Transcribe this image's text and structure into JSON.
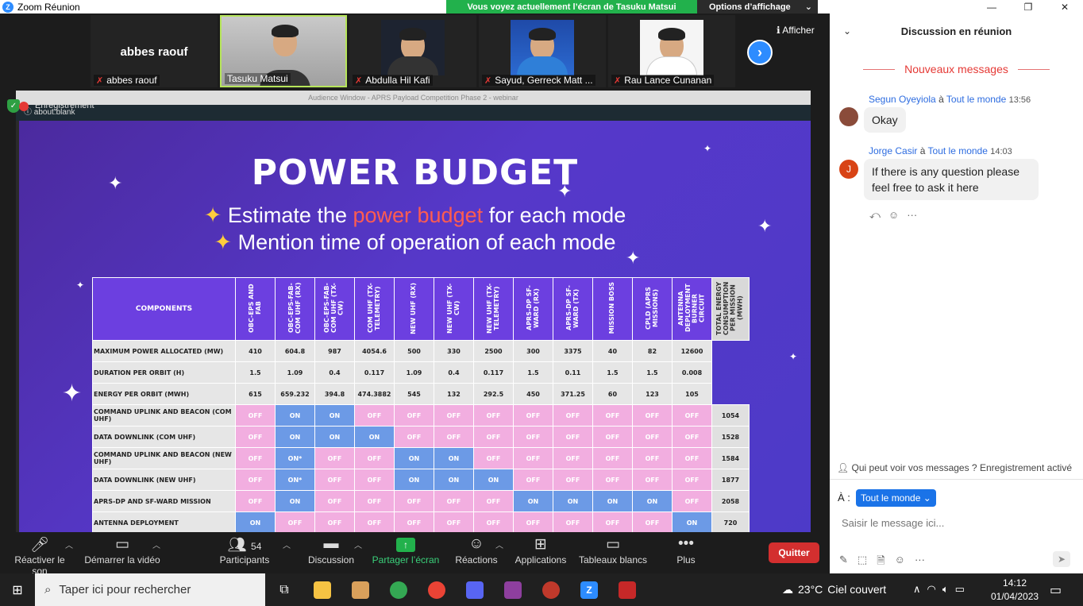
{
  "window": {
    "title": "Zoom Réunion",
    "share_banner": "Vous voyez actuellement l’écran de Tasuku Matsui",
    "view_options": "Options d’affichage",
    "minimize": "—",
    "restore": "❐",
    "close": "✕"
  },
  "strip": {
    "afficher": "Afficher",
    "tiles": [
      {
        "name": "abbes raouf",
        "center": "abbes raouf"
      },
      {
        "name": "Tasuku Matsui"
      },
      {
        "name": "Abdulla Hil Kafi"
      },
      {
        "name": "Sayud, Gerreck Matt ..."
      },
      {
        "name": "Rau Lance Cunanan"
      }
    ]
  },
  "share": {
    "browser_title": "Audience Window - APRS Payload Competition Phase 2 - webinar",
    "address": "about:blank",
    "recording": "Enregistrement"
  },
  "slide": {
    "title": "POWER BUDGET",
    "bullet1_pre": "Estimate the ",
    "bullet1_hl": "power budget",
    "bullet1_post": " for each mode",
    "bullet2": "Mention time of operation of each mode"
  },
  "table": {
    "components_header": "COMPONENTS",
    "total_header": "TOTAL ENERGY CONSUMPTION PER MISSION (MWH)",
    "columns": [
      "OBC-EPS AND FAB",
      "OBC-EPS-FAB-COM UHF (RX)",
      "OBC-EPS-FAB-COM UHF (TX-CW)",
      "COM UHF (TX-TELEMETRY)",
      "NEW UHF (RX)",
      "NEW UHF (TX-CW)",
      "NEW UHF (TX-TELEMETRY)",
      "APRS-DP SF-WARD (RX)",
      "APRS-DP SF-WARD (TX)",
      "MISSION BOSS",
      "CPLD (APRS MISSIONS)",
      "ANTENNA DEPLOYMENT BURNER CIRCUIT"
    ],
    "numeric_rows": [
      {
        "label": "MAXIMUM POWER ALLOCATED (MW)",
        "values": [
          "410",
          "604.8",
          "987",
          "4054.6",
          "500",
          "330",
          "2500",
          "300",
          "3375",
          "40",
          "82",
          "12600"
        ]
      },
      {
        "label": "DURATION PER ORBIT (H)",
        "values": [
          "1.5",
          "1.09",
          "0.4",
          "0.117",
          "1.09",
          "0.4",
          "0.117",
          "1.5",
          "0.11",
          "1.5",
          "1.5",
          "0.008"
        ]
      },
      {
        "label": "ENERGY PER ORBIT (MWH)",
        "values": [
          "615",
          "659.232",
          "394.8",
          "474.3882",
          "545",
          "132",
          "292.5",
          "450",
          "371.25",
          "60",
          "123",
          "105"
        ]
      }
    ],
    "mode_rows": [
      {
        "label": "COMMAND UPLINK AND BEACON (COM UHF)",
        "states": [
          "OFF",
          "ON",
          "ON",
          "OFF",
          "OFF",
          "OFF",
          "OFF",
          "OFF",
          "OFF",
          "OFF",
          "OFF",
          "OFF"
        ],
        "total": "1054"
      },
      {
        "label": "DATA DOWNLINK (COM UHF)",
        "states": [
          "OFF",
          "ON",
          "ON",
          "ON",
          "OFF",
          "OFF",
          "OFF",
          "OFF",
          "OFF",
          "OFF",
          "OFF",
          "OFF"
        ],
        "total": "1528"
      },
      {
        "label": "COMMAND UPLINK AND BEACON (NEW UHF)",
        "states": [
          "OFF",
          "ON*",
          "OFF",
          "OFF",
          "ON",
          "ON",
          "OFF",
          "OFF",
          "OFF",
          "OFF",
          "OFF",
          "OFF"
        ],
        "total": "1584"
      },
      {
        "label": "DATA DOWNLINK (NEW UHF)",
        "states": [
          "OFF",
          "ON*",
          "OFF",
          "OFF",
          "ON",
          "ON",
          "ON",
          "OFF",
          "OFF",
          "OFF",
          "OFF",
          "OFF"
        ],
        "total": "1877"
      },
      {
        "label": "APRS-DP AND SF-WARD MISSION",
        "states": [
          "OFF",
          "ON",
          "OFF",
          "OFF",
          "OFF",
          "OFF",
          "OFF",
          "ON",
          "ON",
          "ON",
          "ON",
          "OFF"
        ],
        "total": "2058"
      },
      {
        "label": "ANTENNA DEPLOYMENT",
        "states": [
          "ON",
          "OFF",
          "OFF",
          "OFF",
          "OFF",
          "OFF",
          "OFF",
          "OFF",
          "OFF",
          "OFF",
          "OFF",
          "ON"
        ],
        "total": "720"
      }
    ]
  },
  "toolbar": {
    "unmute": "Réactiver le son",
    "video": "Démarrer la vidéo",
    "participants": "Participants",
    "participants_count": "54",
    "chat": "Discussion",
    "share": "Partager l’écran",
    "reactions": "Réactions",
    "apps": "Applications",
    "whiteboards": "Tableaux blancs",
    "more": "Plus",
    "quit": "Quitter"
  },
  "chat": {
    "title": "Discussion en réunion",
    "new_messages": "Nouveaux messages",
    "messages": [
      {
        "sender": "Segun Oyeyiola",
        "to_word": "à",
        "recipient": "Tout le monde",
        "time": "13:56",
        "text": "Okay"
      },
      {
        "sender": "Jorge Casir",
        "to_word": "à",
        "recipient": "Tout le monde",
        "time": "14:03",
        "text": "If there is any question please feel free to ask it here",
        "initial": "J"
      }
    ],
    "who_can_see": "Qui peut voir vos messages ? Enregistrement activé",
    "to_label": "À :",
    "to_value": "Tout le monde",
    "input_placeholder": "Saisir le message ici..."
  },
  "taskbar": {
    "search_placeholder": "Taper ici pour rechercher",
    "temperature": "23°C",
    "weather": "Ciel couvert",
    "time": "14:12",
    "date": "01/04/2023"
  },
  "colors": {
    "accent": "#2d8cff",
    "share_green": "#22b14c",
    "quit_red": "#d32f2f",
    "slide_bg": "#5638c9",
    "on_cell": "#6c9ae6",
    "off_cell": "#f2aee0"
  }
}
